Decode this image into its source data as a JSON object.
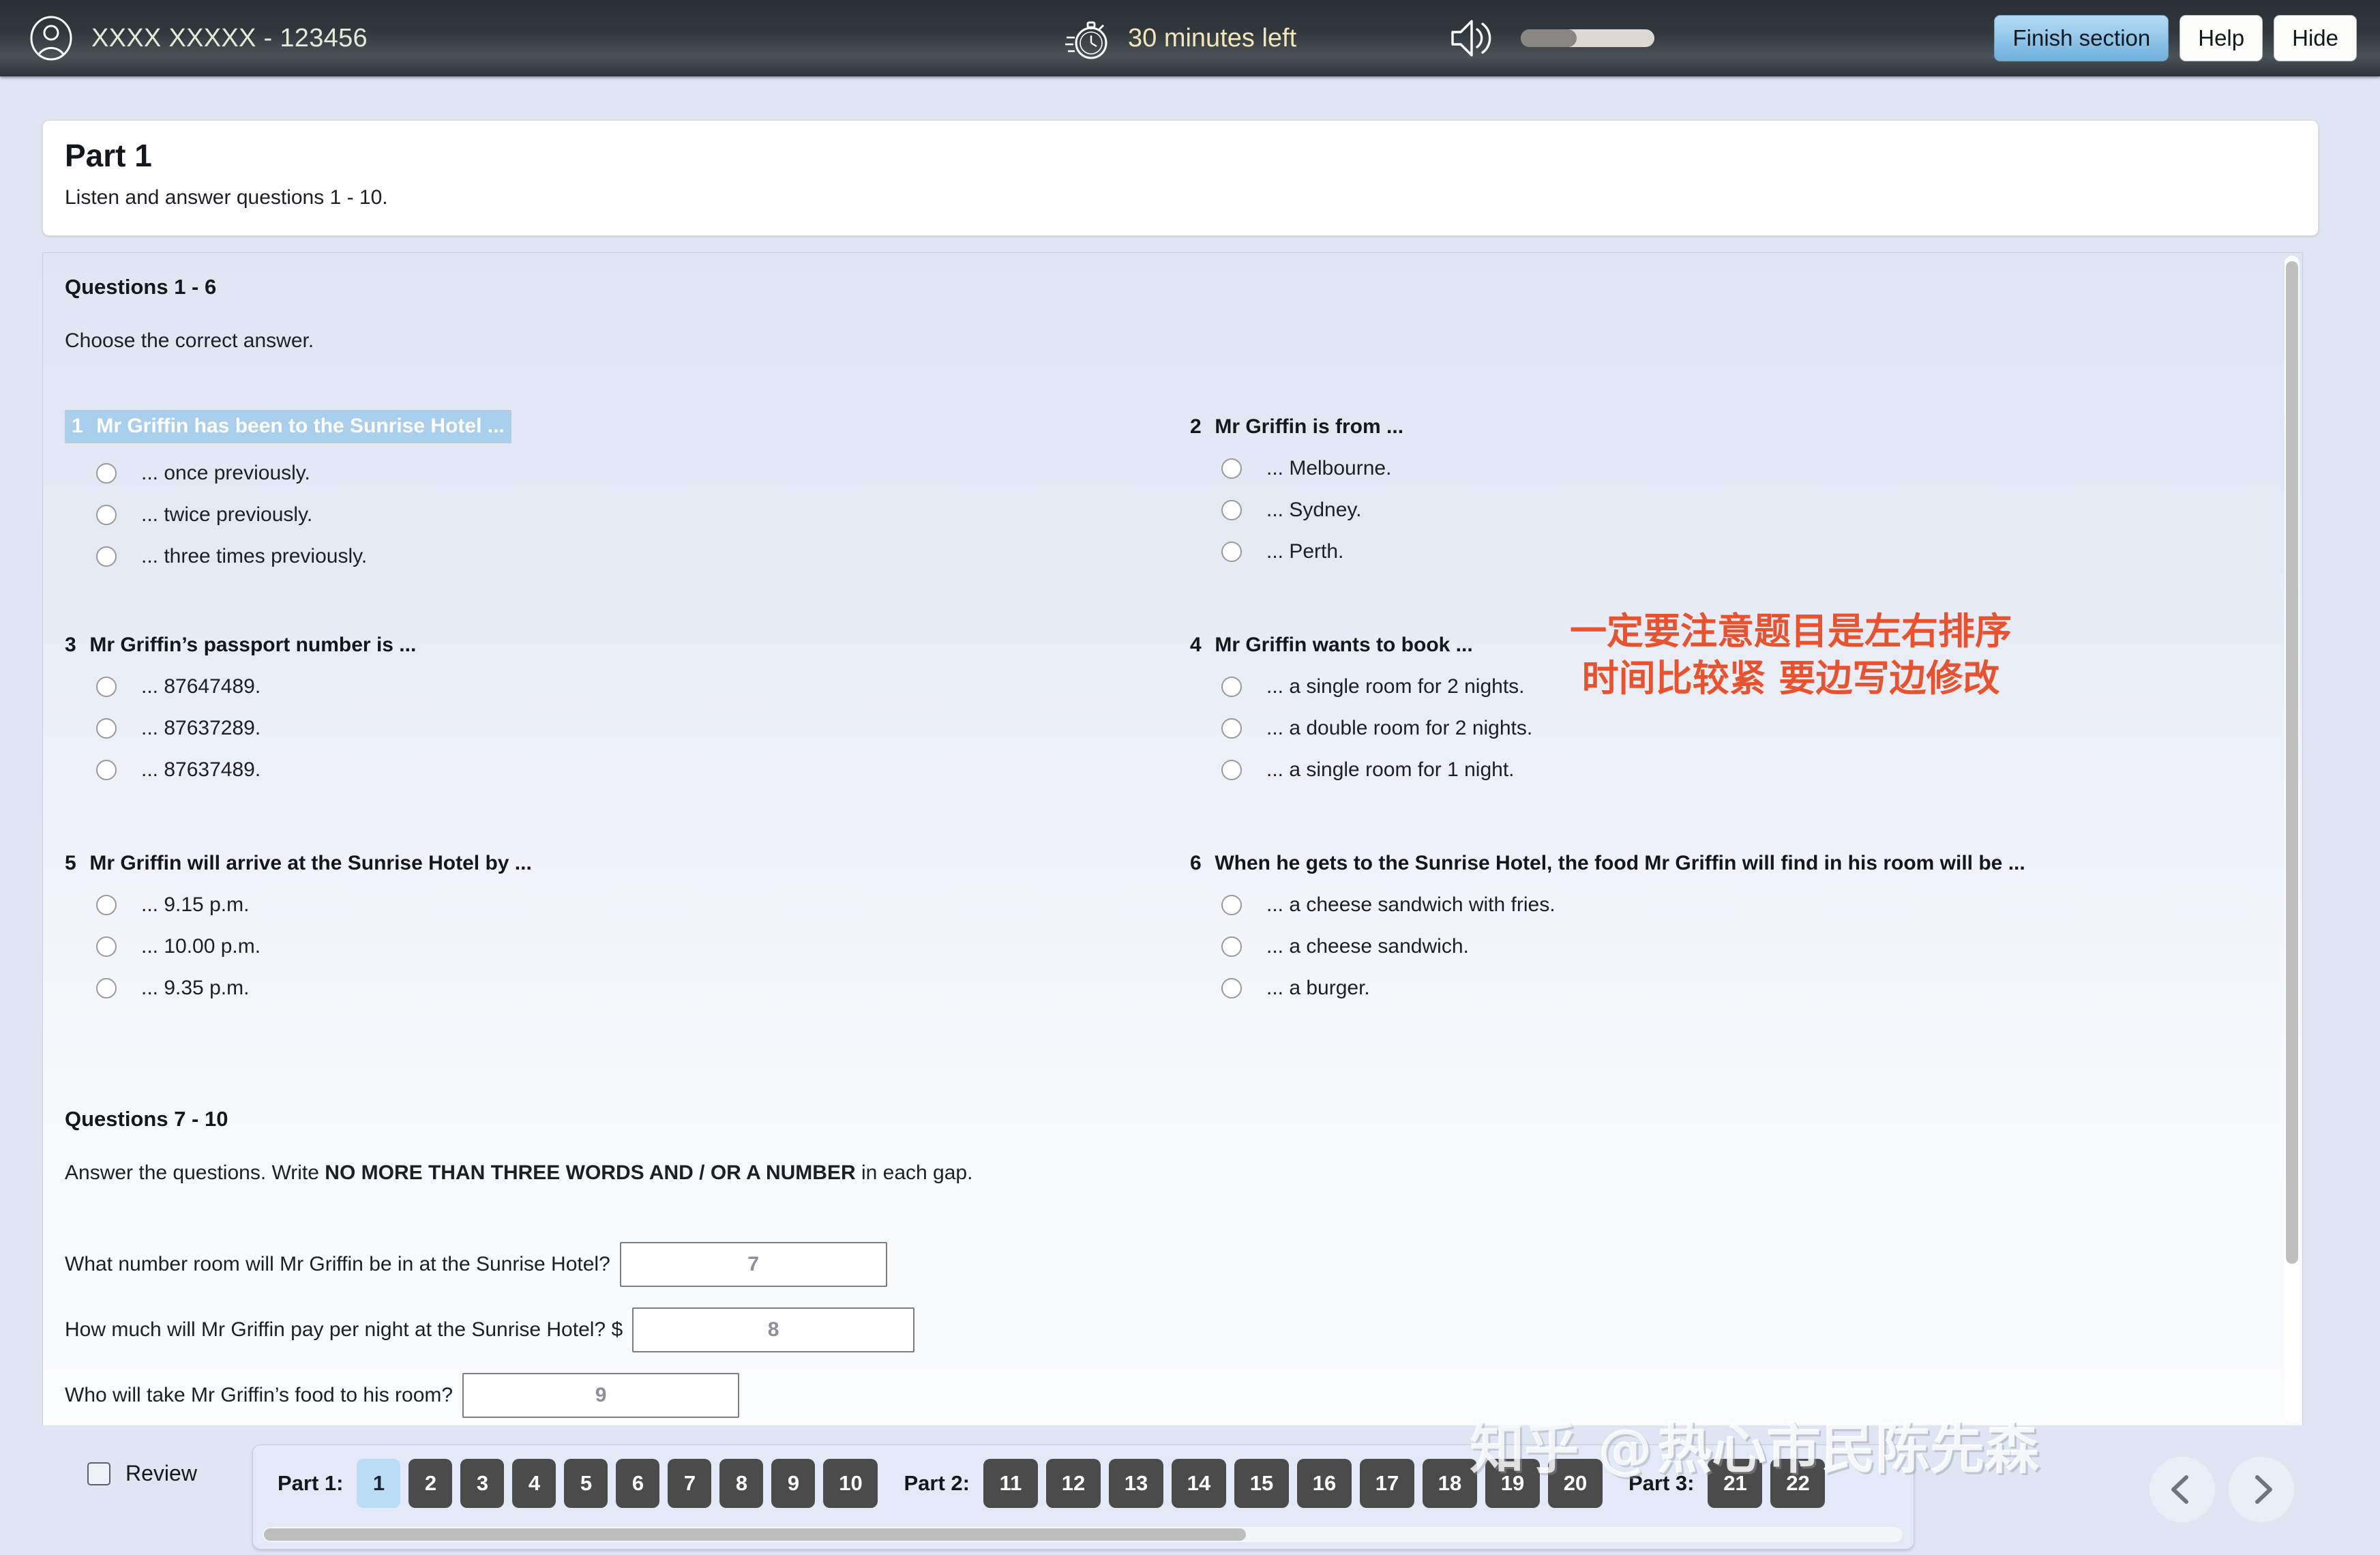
{
  "topbar": {
    "user_name": "XXXX XXXXX - 123456",
    "timer_text": "30 minutes left",
    "volume_percent": 42,
    "finish_label": "Finish section",
    "help_label": "Help",
    "hide_label": "Hide"
  },
  "part_header": {
    "title": "Part 1",
    "subtitle": "Listen and answer questions 1 - 10."
  },
  "section_mc": {
    "title": "Questions 1 - 6",
    "instruction": "Choose the correct answer."
  },
  "annotation": {
    "line1": "一定要注意题目是左右排序",
    "line2": "时间比较紧 要边写边修改",
    "color": "#e8522e"
  },
  "questions": [
    {
      "number": "1",
      "stem": "Mr Griffin has been to the Sunrise Hotel ...",
      "highlighted": true,
      "options": [
        "... once previously.",
        "... twice previously.",
        "... three times previously."
      ]
    },
    {
      "number": "2",
      "stem": "Mr Griffin is from ...",
      "highlighted": false,
      "options": [
        "... Melbourne.",
        "... Sydney.",
        "... Perth."
      ]
    },
    {
      "number": "3",
      "stem": "Mr Griffin’s passport number is ...",
      "highlighted": false,
      "options": [
        "... 87647489.",
        "... 87637289.",
        "... 87637489."
      ]
    },
    {
      "number": "4",
      "stem": "Mr Griffin wants to book ...",
      "highlighted": false,
      "options": [
        "... a single room for 2 nights.",
        "... a double room for 2 nights.",
        "... a single room for 1 night."
      ]
    },
    {
      "number": "5",
      "stem": "Mr Griffin will arrive at the Sunrise Hotel by ...",
      "highlighted": false,
      "options": [
        "... 9.15 p.m.",
        "... 10.00 p.m.",
        "... 9.35 p.m."
      ]
    },
    {
      "number": "6",
      "stem": "When he gets to the Sunrise Hotel, the food Mr Griffin will find in his room will be ...",
      "highlighted": false,
      "options": [
        "... a cheese sandwich with fries.",
        "... a cheese sandwich.",
        "... a burger."
      ]
    }
  ],
  "section_gap": {
    "title": "Questions 7 - 10",
    "instruction_pre": "Answer the questions. Write ",
    "instruction_bold": "NO MORE THAN THREE WORDS AND / OR A NUMBER",
    "instruction_post": " in each gap."
  },
  "gaps": [
    {
      "prompt": "What number room will Mr Griffin be in at the Sunrise Hotel?",
      "placeholder": "7",
      "value": ""
    },
    {
      "prompt": "How much will Mr Griffin pay per night at the Sunrise Hotel? $",
      "placeholder": "8",
      "value": ""
    },
    {
      "prompt": "Who will take Mr Griffin’s food to his room?",
      "placeholder": "9",
      "value": ""
    }
  ],
  "bottombar": {
    "review_label": "Review",
    "part1_label": "Part 1:",
    "part1_buttons": [
      "1",
      "2",
      "3",
      "4",
      "5",
      "6",
      "7",
      "8",
      "9",
      "10"
    ],
    "part1_active": "1",
    "part2_label": "Part 2:",
    "part2_buttons": [
      "11",
      "12",
      "13",
      "14",
      "15",
      "16",
      "17",
      "18",
      "19",
      "20"
    ],
    "part3_label": "Part 3:",
    "part3_buttons": [
      "21",
      "22"
    ]
  },
  "watermark": {
    "left_text": "知乎 @",
    "right_text": "热心市民陈先森"
  }
}
